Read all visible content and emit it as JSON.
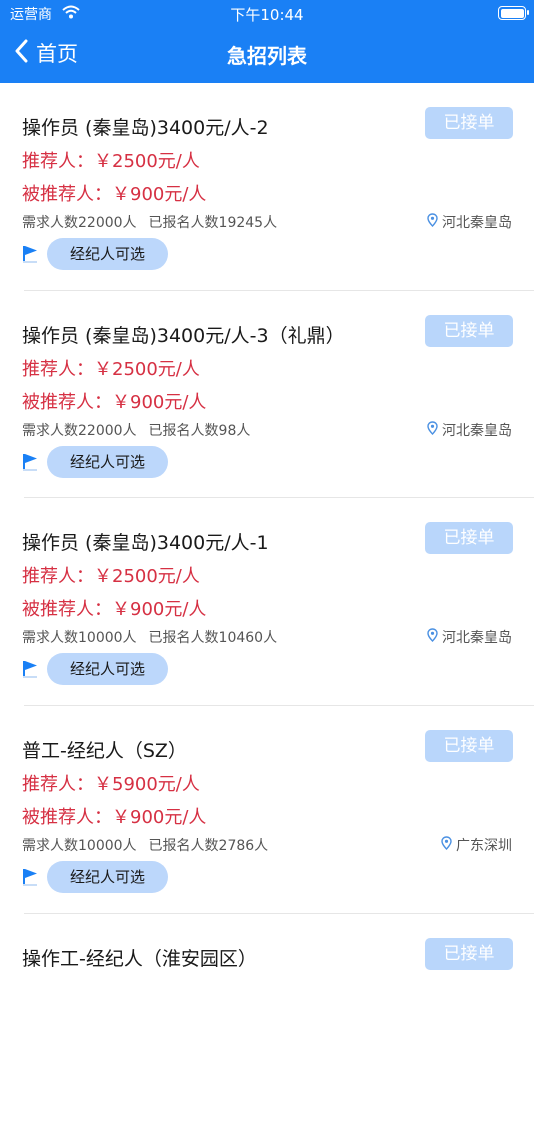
{
  "status_bar": {
    "carrier": "运营商",
    "time": "下午10:44"
  },
  "nav": {
    "back_label": "首页",
    "title": "急招列表"
  },
  "jobs": [
    {
      "title": "操作员 (秦皇岛)3400元/人-2",
      "button": "已接单",
      "referrer": "推荐人：￥2500元/人",
      "referee": "被推荐人：￥900元/人",
      "demand": "需求人数22000人",
      "registered": "已报名人数19245人",
      "location": "河北秦皇岛",
      "tag": "经纪人可选"
    },
    {
      "title": "操作员 (秦皇岛)3400元/人-3（礼鼎）",
      "button": "已接单",
      "referrer": "推荐人：￥2500元/人",
      "referee": "被推荐人：￥900元/人",
      "demand": "需求人数22000人",
      "registered": "已报名人数98人",
      "location": "河北秦皇岛",
      "tag": "经纪人可选"
    },
    {
      "title": "操作员 (秦皇岛)3400元/人-1",
      "button": "已接单",
      "referrer": "推荐人：￥2500元/人",
      "referee": "被推荐人：￥900元/人",
      "demand": "需求人数10000人",
      "registered": "已报名人数10460人",
      "location": "河北秦皇岛",
      "tag": "经纪人可选"
    },
    {
      "title": "普工-经纪人（SZ）",
      "button": "已接单",
      "referrer": "推荐人：￥5900元/人",
      "referee": "被推荐人：￥900元/人",
      "demand": "需求人数10000人",
      "registered": "已报名人数2786人",
      "location": "广东深圳",
      "tag": "经纪人可选"
    },
    {
      "title": "操作工-经纪人（淮安园区）",
      "button": "已接单",
      "referrer": "",
      "referee": "",
      "demand": "",
      "registered": "",
      "location": "",
      "tag": ""
    }
  ],
  "colors": {
    "primary": "#1a80f5",
    "button_bg": "#b9d6fb",
    "price_red": "#d63043"
  },
  "icons": {
    "back": "chevron-left-icon",
    "location": "location-pin-icon",
    "flag": "flag-icon",
    "wifi": "wifi-icon",
    "battery": "battery-icon"
  }
}
